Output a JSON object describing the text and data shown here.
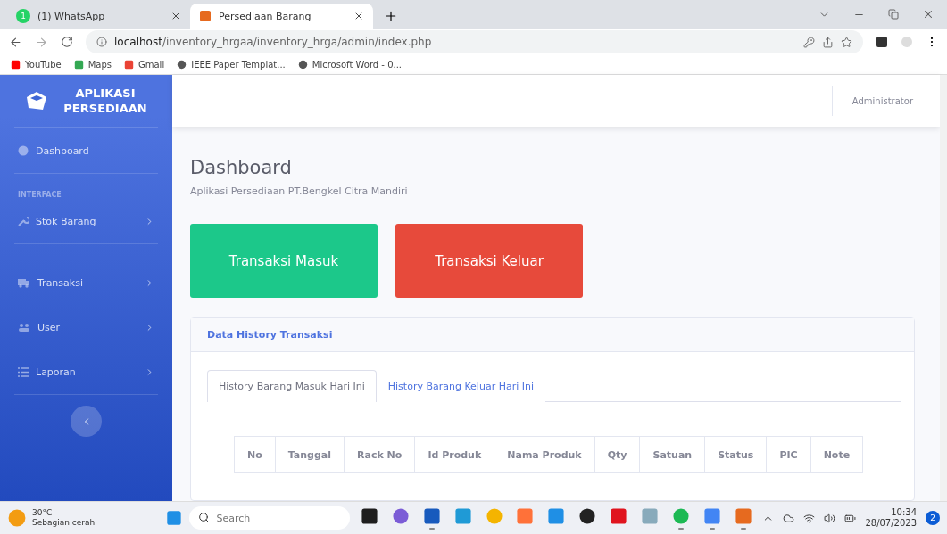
{
  "browser": {
    "tabs": [
      {
        "title": "(1) WhatsApp",
        "badge": "1",
        "selected": false
      },
      {
        "title": "Persediaan Barang",
        "selected": true
      }
    ],
    "url_host": "localhost",
    "url_path": "/inventory_hrgaa/inventory_hrga/admin/index.php",
    "bookmarks": [
      "YouTube",
      "Maps",
      "Gmail",
      "IEEE Paper Templat...",
      "Microsoft Word - 0..."
    ]
  },
  "sidebar": {
    "brand": "APLIKASI PERSEDIAAN",
    "items": [
      {
        "kind": "link",
        "label": "Dashboard"
      },
      {
        "kind": "heading",
        "label": "INTERFACE"
      },
      {
        "kind": "menu",
        "label": "Stok Barang"
      },
      {
        "kind": "menu",
        "label": "Transaksi"
      },
      {
        "kind": "menu",
        "label": "User"
      },
      {
        "kind": "menu",
        "label": "Laporan"
      }
    ]
  },
  "topbar": {
    "user": "Administrator"
  },
  "page": {
    "title": "Dashboard",
    "subtitle": "Aplikasi Persediaan PT.Bengkel Citra Mandiri",
    "buttons": [
      {
        "label": "Transaksi Masuk",
        "color": "#1cc88a"
      },
      {
        "label": "Transaksi Keluar",
        "color": "#e74a3b"
      }
    ]
  },
  "card": {
    "title": "Data History Transaksi",
    "tabs": [
      {
        "label": "History Barang Masuk Hari Ini",
        "selected": true
      },
      {
        "label": "History Barang Keluar Hari Ini",
        "selected": false
      }
    ],
    "columns": [
      "No",
      "Tanggal",
      "Rack No",
      "Id Produk",
      "Nama Produk",
      "Qty",
      "Satuan",
      "Status",
      "PIC",
      "Note"
    ]
  },
  "taskbar": {
    "temperature": "30°C",
    "weather": "Sebagian cerah",
    "search_placeholder": "Search",
    "time": "10:34",
    "date": "28/07/2023",
    "notifications": "2",
    "apps": [
      {
        "running": false
      },
      {
        "running": false
      },
      {
        "running": true
      },
      {
        "running": false
      },
      {
        "running": false
      },
      {
        "running": false
      },
      {
        "running": false
      },
      {
        "running": false
      },
      {
        "running": false
      },
      {
        "running": false
      },
      {
        "running": true
      },
      {
        "running": true
      },
      {
        "running": true
      }
    ]
  }
}
